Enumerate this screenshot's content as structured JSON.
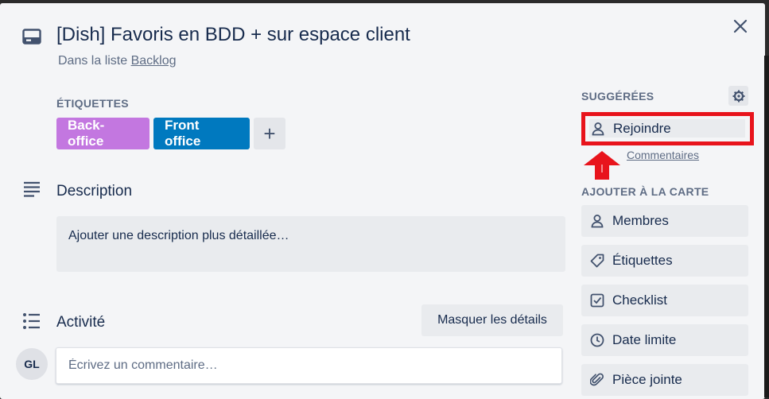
{
  "card": {
    "title": "[Dish] Favoris en BDD + sur espace client",
    "list_prefix": "Dans la liste ",
    "list_name": "Backlog"
  },
  "labels": {
    "heading": "Étiquettes",
    "items": [
      {
        "text": "Back-office",
        "color": "#c377e0"
      },
      {
        "text": "Front office",
        "color": "#0079bf"
      }
    ],
    "add_symbol": "+"
  },
  "description": {
    "heading": "Description",
    "placeholder": "Ajouter une description plus détaillée…"
  },
  "activity": {
    "heading": "Activité",
    "toggle_label": "Masquer les détails",
    "avatar_initials": "GL",
    "comment_placeholder": "Écrivez un commentaire…"
  },
  "sidebar": {
    "suggested_heading": "Suggérées",
    "join_label": "Rejoindre",
    "comments_link": "Commentaires",
    "add_heading": "Ajouter à la carte",
    "buttons": [
      {
        "label": "Membres",
        "icon": "person-icon"
      },
      {
        "label": "Étiquettes",
        "icon": "tag-icon"
      },
      {
        "label": "Checklist",
        "icon": "checkbox-icon"
      },
      {
        "label": "Date limite",
        "icon": "clock-icon"
      },
      {
        "label": "Pièce jointe",
        "icon": "paperclip-icon"
      }
    ]
  },
  "colors": {
    "highlight": "#e8141c",
    "accent": "#0079bf"
  }
}
